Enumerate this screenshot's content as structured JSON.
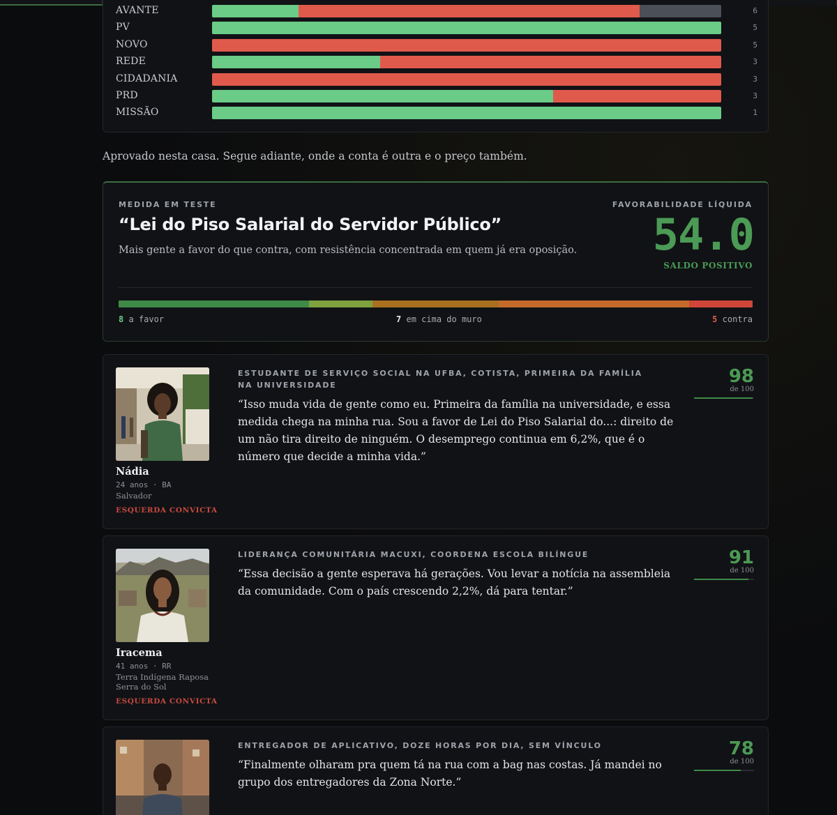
{
  "parties": [
    {
      "name": "AVANTE",
      "count": "6",
      "fav": 0.17,
      "contra": 0.67,
      "neutral": 0.16
    },
    {
      "name": "PV",
      "count": "5",
      "fav": 1.0,
      "contra": 0.0,
      "neutral": 0.0
    },
    {
      "name": "NOVO",
      "count": "5",
      "fav": 0.0,
      "contra": 1.0,
      "neutral": 0.0
    },
    {
      "name": "REDE",
      "count": "3",
      "fav": 0.33,
      "contra": 0.67,
      "neutral": 0.0
    },
    {
      "name": "CIDADANIA",
      "count": "3",
      "fav": 0.0,
      "contra": 1.0,
      "neutral": 0.0
    },
    {
      "name": "PRD",
      "count": "3",
      "fav": 0.67,
      "contra": 0.33,
      "neutral": 0.0
    },
    {
      "name": "MISSÃO",
      "count": "1",
      "fav": 1.0,
      "contra": 0.0,
      "neutral": 0.0
    }
  ],
  "lead_text": "Aprovado nesta casa. Segue adiante, onde a conta é outra e o preço também.",
  "measure": {
    "eyebrow": "MEDIDA EM TESTE",
    "title": "“Lei do Piso Salarial do Servidor Público”",
    "subtitle": "Mais gente a favor do que contra, com resistência concentrada em quem já era oposição.",
    "score_eyebrow": "FAVORABILIDADE LÍQUIDA",
    "score": "54.0",
    "score_label": "SALDO POSITIVO",
    "favor_count": "8",
    "favor_label": "a favor",
    "mid_count": "7",
    "mid_label": "em cima do muro",
    "contra_count": "5",
    "contra_label": "contra"
  },
  "personas": [
    {
      "role": "ESTUDANTE DE SERVIÇO SOCIAL NA UFBA, COTISTA, PRIMEIRA DA FAMÍLIA NA UNIVERSIDADE",
      "quote": "“Isso muda vida de gente como eu. Primeira da família na universidade, e essa medida chega na minha rua. Sou a favor de Lei do Piso Salarial do...: direito de um não tira direito de ninguém. O desemprego continua em 6,2%, que é o número que decide a minha vida.”",
      "name": "Nádia",
      "meta": "24 anos · BA",
      "place": "Salvador",
      "lean": "ESQUERDA CONVICTA",
      "score": "98",
      "score_of": "de 100",
      "score_value": 98
    },
    {
      "role": "LIDERANÇA COMUNITÁRIA MACUXI, COORDENA ESCOLA BILÍNGUE",
      "quote": "“Essa decisão a gente esperava há gerações. Vou levar a notícia na assembleia da comunidade. Com o país crescendo 2,2%, dá para tentar.”",
      "name": "Iracema",
      "meta": "41 anos · RR",
      "place": "Terra Indígena Raposa Serra do Sol",
      "lean": "ESQUERDA CONVICTA",
      "score": "91",
      "score_of": "de 100",
      "score_value": 91
    },
    {
      "role": "ENTREGADOR DE APLICATIVO, DOZE HORAS POR DIA, SEM VÍNCULO",
      "quote": "“Finalmente olharam pra quem tá na rua com a bag nas costas. Já mandei no grupo dos entregadores da Zona Norte.”",
      "score": "78",
      "score_of": "de 100",
      "score_value": 78
    }
  ]
}
